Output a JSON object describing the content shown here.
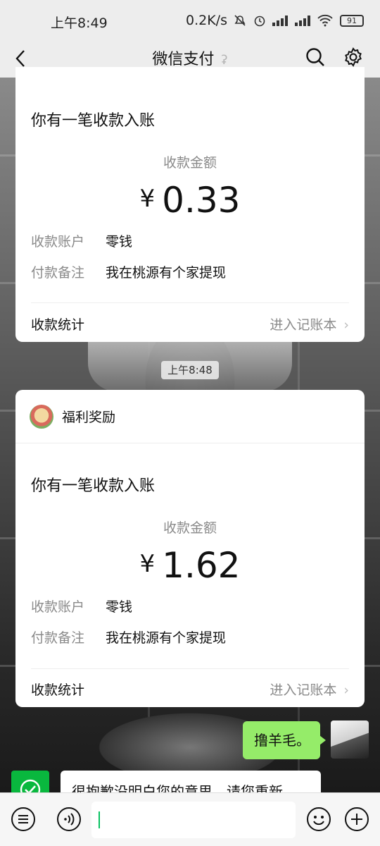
{
  "status_bar": {
    "time": "上午8:49",
    "network_speed": "0.2K/s",
    "battery": "91"
  },
  "nav": {
    "title": "微信支付"
  },
  "cards": [
    {
      "headline": "你有一笔收款入账",
      "amount_label": "收款金额",
      "currency": "¥",
      "amount": "0.33",
      "rows": [
        {
          "key": "收款账户",
          "value": "零钱"
        },
        {
          "key": "付款备注",
          "value": "我在桃源有个家提现"
        }
      ],
      "footer_label": "收款统计",
      "footer_link": "进入记账本"
    },
    {
      "sender": "福利奖励",
      "headline": "你有一笔收款入账",
      "amount_label": "收款金额",
      "currency": "¥",
      "amount": "1.62",
      "rows": [
        {
          "key": "收款账户",
          "value": "零钱"
        },
        {
          "key": "付款备注",
          "value": "我在桃源有个家提现"
        }
      ],
      "footer_label": "收款统计",
      "footer_link": "进入记账本"
    }
  ],
  "timestamp": "上午8:48",
  "messages": {
    "mine": "撸羊毛。",
    "bot": "很抱歉没明白您的意思，请您重新"
  },
  "colors": {
    "accent_green": "#07c160",
    "bubble_green": "#95ec69"
  }
}
